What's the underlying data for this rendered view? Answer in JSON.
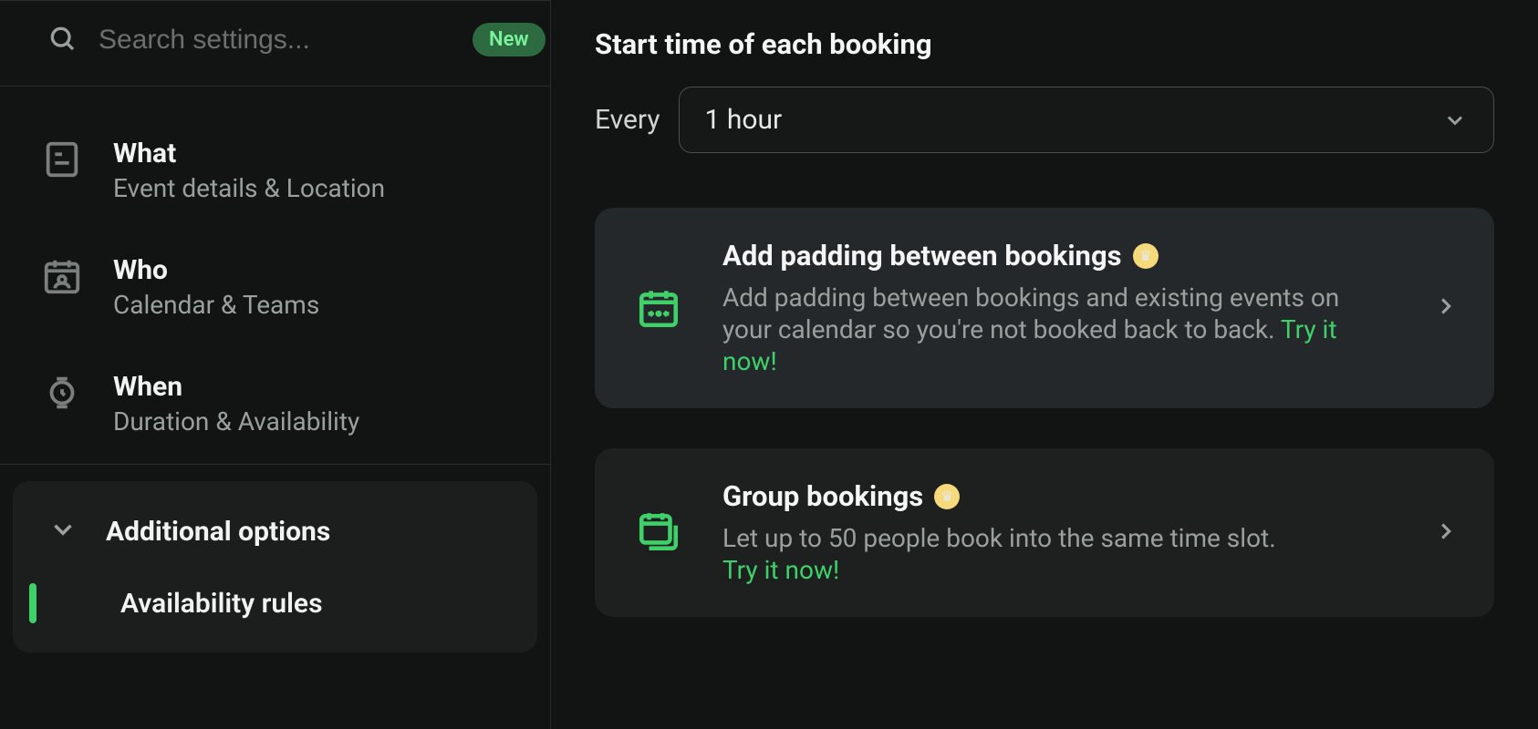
{
  "sidebar": {
    "search_placeholder": "Search settings...",
    "badge": "New",
    "nav": [
      {
        "title": "What",
        "subtitle": "Event details & Location"
      },
      {
        "title": "Who",
        "subtitle": "Calendar & Teams"
      },
      {
        "title": "When",
        "subtitle": "Duration & Availability"
      }
    ],
    "additional_label": "Additional options",
    "active_item": "Availability rules"
  },
  "main": {
    "section_title": "Start time of each booking",
    "interval_label": "Every",
    "interval_value": "1 hour",
    "cards": [
      {
        "title": "Add padding between bookings",
        "desc": "Add padding between bookings and existing events on your calendar so you're not booked back to back.",
        "cta": "Try it now!"
      },
      {
        "title": "Group bookings",
        "desc": "Let up to 50 people book into the same time slot.",
        "cta": "Try it now!"
      }
    ]
  }
}
